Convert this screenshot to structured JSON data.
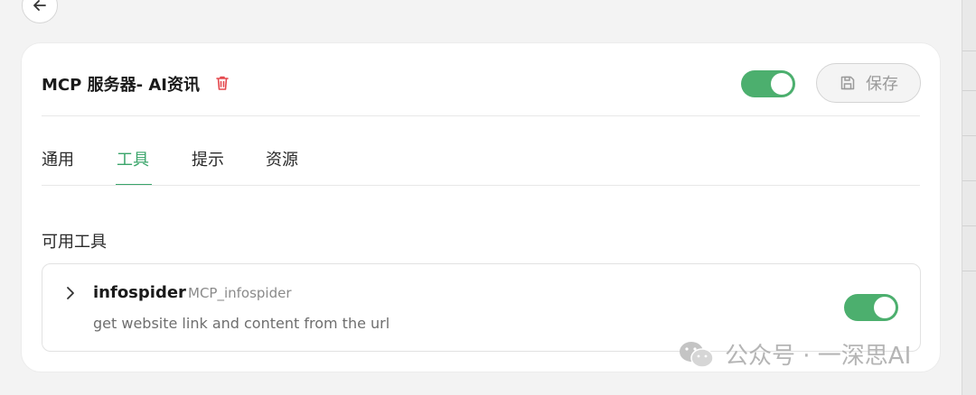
{
  "server": {
    "title": "MCP 服务器- AI资讯",
    "enabled": true,
    "save_label": "保存"
  },
  "tabs": [
    {
      "label": "通用",
      "active": false
    },
    {
      "label": "工具",
      "active": true
    },
    {
      "label": "提示",
      "active": false
    },
    {
      "label": "资源",
      "active": false
    }
  ],
  "tools_section": {
    "title": "可用工具",
    "items": [
      {
        "name": "infospider",
        "id": "MCP_infospider",
        "description": "get website link and content from the url",
        "enabled": true
      }
    ]
  },
  "watermark": {
    "text": "公众号 · 一深思AI"
  },
  "colors": {
    "accent": "#4caf6e",
    "tab_active": "#3aa56a",
    "danger": "#e5484d"
  },
  "icons": {
    "back": "arrow-left-icon",
    "delete": "trash-icon",
    "save": "floppy-disk-icon",
    "expand": "chevron-right-icon",
    "watermark": "wechat-icon"
  }
}
